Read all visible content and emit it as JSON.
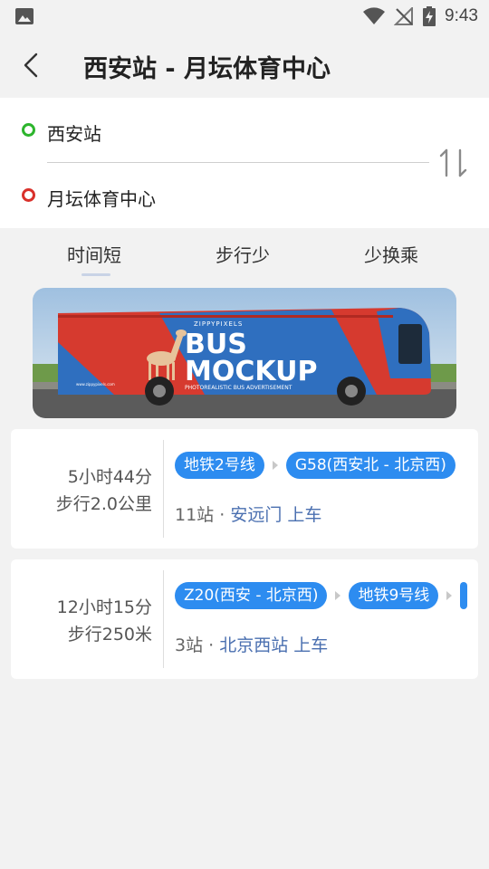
{
  "status_bar": {
    "time": "9:43"
  },
  "header": {
    "title": "西安站 - 月坛体育中心"
  },
  "route": {
    "origin": "西安站",
    "destination": "月坛体育中心"
  },
  "tabs": [
    {
      "label": "时间短",
      "selected": true
    },
    {
      "label": "步行少",
      "selected": false
    },
    {
      "label": "少换乘",
      "selected": false
    }
  ],
  "banner": {
    "brand_small": "ZIPPYPIXELS",
    "headline_1": "BUS",
    "headline_2": "MOCKUP",
    "tagline": "PHOTOREALISTIC BUS ADVERTISEMENT",
    "url": "www.zippypixels.com"
  },
  "plans": [
    {
      "duration": "5小时44分",
      "walk": "步行2.0公里",
      "segments": [
        "地铁2号线",
        "G58(西安北 - 北京西)"
      ],
      "stops": "11站",
      "separator": "·",
      "boarding": "安远门 上车"
    },
    {
      "duration": "12小时15分",
      "walk": "步行250米",
      "segments": [
        "Z20(西安 - 北京西)",
        "地铁9号线"
      ],
      "stops": "3站",
      "separator": "·",
      "boarding": "北京西站 上车"
    }
  ],
  "colors": {
    "accent": "#2d8cf0",
    "origin_dot": "#2db52d",
    "destination_dot": "#d9312b",
    "station_link": "#4a6fb0"
  }
}
